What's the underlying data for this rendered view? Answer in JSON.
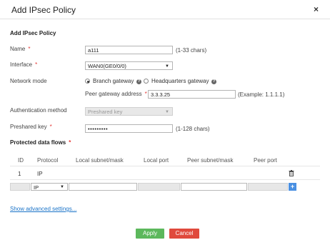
{
  "dialog": {
    "title": "Add IPsec Policy",
    "close_symbol": "×"
  },
  "section_title": "Add IPsec Policy",
  "fields": {
    "name": {
      "label": "Name",
      "required_mark": "*",
      "value": "a111",
      "hint": "(1-33 chars)"
    },
    "interface": {
      "label": "Interface",
      "required_mark": "*",
      "value": "WAN0(GE0/0/0)"
    },
    "network_mode": {
      "label": "Network mode",
      "options": [
        "Branch gateway",
        "Headquarters gateway"
      ],
      "selected": "Branch gateway",
      "help_symbol": "?"
    },
    "peer_gateway": {
      "label": "Peer gateway address",
      "required_mark": "*",
      "value": "3.3.3.25",
      "hint": "(Example: 1.1.1.1)"
    },
    "auth_method": {
      "label": "Authentication method",
      "value": "Preshared key"
    },
    "preshared_key": {
      "label": "Preshared key",
      "required_mark": "*",
      "value": "•••••••••",
      "hint": "(1-128 chars)"
    }
  },
  "flows": {
    "title": "Protected data flows",
    "required_mark": "*",
    "columns": [
      "ID",
      "Protocol",
      "Local subnet/mask",
      "Local port",
      "Peer subnet/mask",
      "Peer port"
    ],
    "rows": [
      {
        "id": "1",
        "protocol": "IP"
      }
    ],
    "new_row": {
      "protocol": "IP",
      "add_symbol": "+"
    }
  },
  "advanced_link": "Show advanced settings...",
  "buttons": {
    "apply": "Apply",
    "cancel": "Cancel"
  },
  "colors": {
    "apply": "#5cb85c",
    "cancel": "#e0493c",
    "link": "#1a73c8",
    "add": "#4a90e2",
    "required": "#e53935"
  }
}
